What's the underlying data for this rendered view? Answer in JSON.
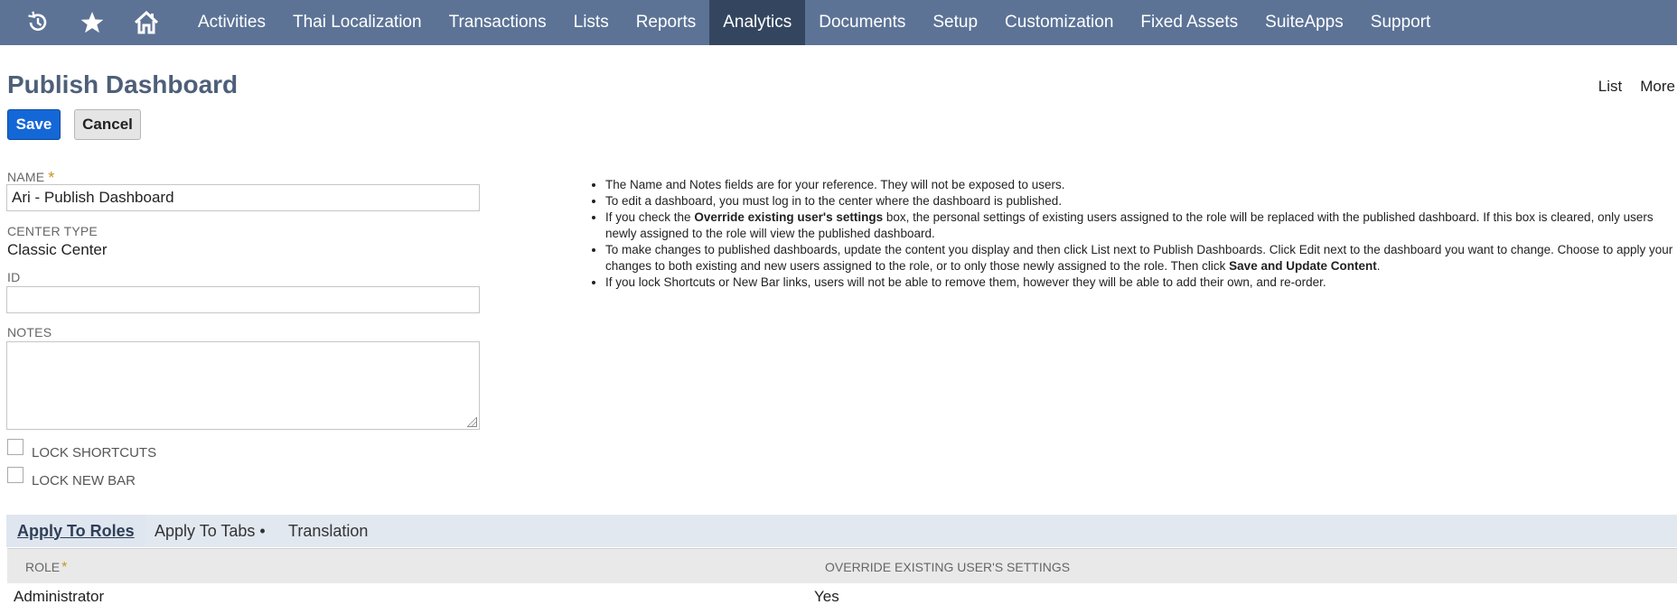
{
  "nav": {
    "icons": [
      "recent-icon",
      "star-icon",
      "home-icon"
    ],
    "items": [
      {
        "label": "Activities"
      },
      {
        "label": "Thai Localization"
      },
      {
        "label": "Transactions"
      },
      {
        "label": "Lists"
      },
      {
        "label": "Reports"
      },
      {
        "label": "Analytics",
        "active": true
      },
      {
        "label": "Documents"
      },
      {
        "label": "Setup"
      },
      {
        "label": "Customization"
      },
      {
        "label": "Fixed Assets"
      },
      {
        "label": "SuiteApps"
      },
      {
        "label": "Support"
      }
    ],
    "colors": {
      "bar": "#5c7396",
      "active": "#34465f"
    }
  },
  "page": {
    "title": "Publish Dashboard",
    "links": {
      "list": "List",
      "more": "More"
    },
    "buttons": {
      "save": "Save",
      "cancel": "Cancel"
    }
  },
  "form": {
    "name_label": "NAME",
    "name_value": "Ari - Publish Dashboard",
    "center_type_label": "CENTER TYPE",
    "center_type_value": "Classic Center",
    "id_label": "ID",
    "id_value": "",
    "notes_label": "NOTES",
    "lock_shortcuts_label": "LOCK SHORTCUTS",
    "lock_shortcuts_checked": false,
    "lock_new_bar_label": "LOCK NEW BAR",
    "lock_new_bar_checked": false
  },
  "help": {
    "bullets": [
      {
        "parts": [
          {
            "t": "The Name and Notes fields are for your reference. They will not be exposed to users."
          }
        ]
      },
      {
        "parts": [
          {
            "t": "To edit a dashboard, you must log in to the center where the dashboard is published."
          }
        ]
      },
      {
        "parts": [
          {
            "t": "If you check the "
          },
          {
            "t": "Override existing user's settings",
            "b": true
          },
          {
            "t": " box, the personal settings of existing users assigned to the role will be replaced with the published dashboard. If this box is cleared, only users newly assigned to the role will view the published dashboard."
          }
        ]
      },
      {
        "parts": [
          {
            "t": "To make changes to published dashboards, update the content you display and then click List next to Publish Dashboards. Click Edit next to the dashboard you want to change. Choose to apply your changes to both existing and new users assigned to the role, or to only those newly assigned to the role. Then click "
          },
          {
            "t": "Save and Update Content",
            "b": true
          },
          {
            "t": "."
          }
        ]
      },
      {
        "parts": [
          {
            "t": "If you lock Shortcuts or New Bar links, users will not be able to remove them, however they will be able to add their own, and re-order."
          }
        ]
      }
    ]
  },
  "subtabs": {
    "items": [
      {
        "label": "Apply To Roles",
        "active": true
      },
      {
        "label": "Apply To Tabs •"
      },
      {
        "label": "Translation"
      }
    ]
  },
  "table": {
    "headers": {
      "role": "ROLE",
      "override": "OVERRIDE EXISTING USER'S SETTINGS"
    },
    "rows": [
      {
        "role": "Administrator",
        "override": "Yes"
      }
    ]
  },
  "colors": {
    "title": "#4d5f79",
    "required": "#c8951f",
    "save_button": "#1467d6"
  }
}
